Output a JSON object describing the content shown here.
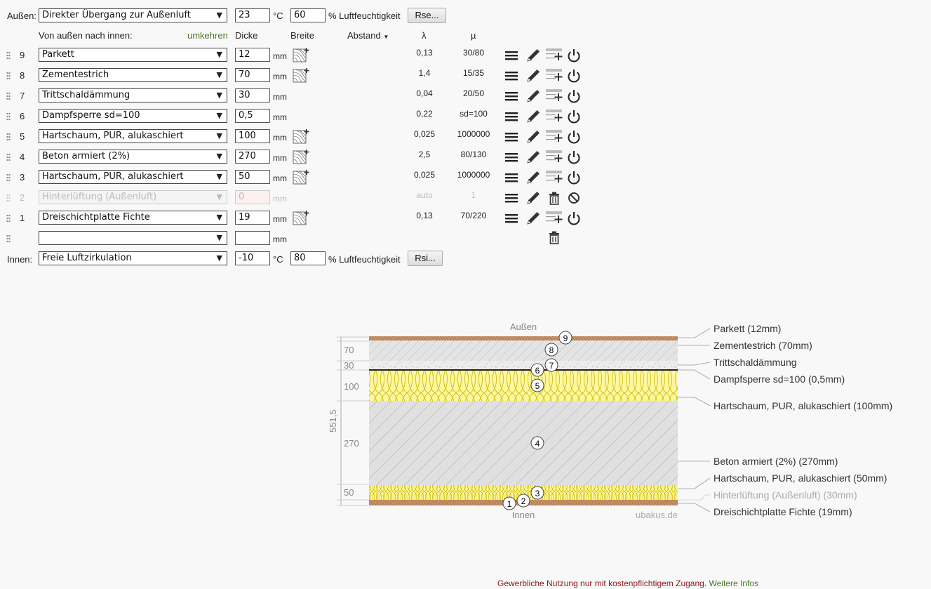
{
  "outside": {
    "label": "Außen:",
    "condition": "Direkter Übergang zur Außenluft",
    "temp": "23",
    "temp_unit": "°C",
    "humidity": "60",
    "humidity_label": "% Luftfeuchtigkeit",
    "rse_button": "Rse..."
  },
  "header": {
    "direction": "Von außen nach innen:",
    "reverse_link": "umkehren",
    "thickness": "Dicke",
    "width": "Breite",
    "spacing": "Abstand",
    "lambda": "λ",
    "mu": "µ"
  },
  "unit_mm": "mm",
  "layers": [
    {
      "nr": "9",
      "material": "Parkett",
      "thickness": "12",
      "lambda": "0,13",
      "mu": "30/80",
      "width_icon": true,
      "disabled": false
    },
    {
      "nr": "8",
      "material": "Zementestrich",
      "thickness": "70",
      "lambda": "1,4",
      "mu": "15/35",
      "width_icon": true,
      "disabled": false
    },
    {
      "nr": "7",
      "material": "Trittschaldämmung",
      "thickness": "30",
      "lambda": "0,04",
      "mu": "20/50",
      "width_icon": false,
      "disabled": false
    },
    {
      "nr": "6",
      "material": "Dampfsperre sd=100",
      "thickness": "0,5",
      "lambda": "0,22",
      "mu": "sd=100",
      "width_icon": false,
      "disabled": false
    },
    {
      "nr": "5",
      "material": "Hartschaum, PUR, alukaschiert",
      "thickness": "100",
      "lambda": "0,025",
      "mu": "1000000",
      "width_icon": true,
      "disabled": false
    },
    {
      "nr": "4",
      "material": "Beton armiert (2%)",
      "thickness": "270",
      "lambda": "2,5",
      "mu": "80/130",
      "width_icon": true,
      "disabled": false
    },
    {
      "nr": "3",
      "material": "Hartschaum, PUR, alukaschiert",
      "thickness": "50",
      "lambda": "0,025",
      "mu": "1000000",
      "width_icon": true,
      "disabled": false
    },
    {
      "nr": "2",
      "material": "Hinterlüftung (Außenluft)",
      "thickness": "0",
      "lambda": "auto",
      "mu": "1",
      "width_icon": false,
      "disabled": true
    },
    {
      "nr": "1",
      "material": "Dreischichtplatte Fichte",
      "thickness": "19",
      "lambda": "0,13",
      "mu": "70/220",
      "width_icon": true,
      "disabled": false
    }
  ],
  "inside": {
    "label": "Innen:",
    "condition": "Freie Luftzirkulation",
    "temp": "-10",
    "temp_unit": "°C",
    "humidity": "80",
    "humidity_label": "% Luftfeuchtigkeit",
    "rsi_button": "Rsi..."
  },
  "diagram": {
    "top_label": "Außen",
    "bottom_label": "Innen",
    "watermark": "ubakus.de",
    "total_thickness": "551,5",
    "dimension_labels": [
      "70",
      "30",
      "100",
      "270",
      "50"
    ],
    "legend": [
      "Parkett (12mm)",
      "Zementestrich (70mm)",
      "Trittschaldämmung",
      "Dampfsperre sd=100 (0,5mm)",
      "Hartschaum, PUR, alukaschiert (100mm)",
      "Beton armiert (2%) (270mm)",
      "Hartschaum, PUR, alukaschiert (50mm)",
      "Hinterlüftung (Außenluft) (30mm)",
      "Dreischichtplatte Fichte (19mm)"
    ],
    "markers": [
      "9",
      "8",
      "7",
      "6",
      "5",
      "4",
      "3",
      "2",
      "1"
    ],
    "colors": {
      "wood": "#c8956a",
      "insulation": "#fff7a0",
      "concrete": "#e0e0e0",
      "screed": "#e3e3e3"
    }
  },
  "footer": {
    "notice": "Gewerbliche Nutzung nur mit kostenpflichtigem Zugang.",
    "more_info": "Weitere Infos"
  }
}
